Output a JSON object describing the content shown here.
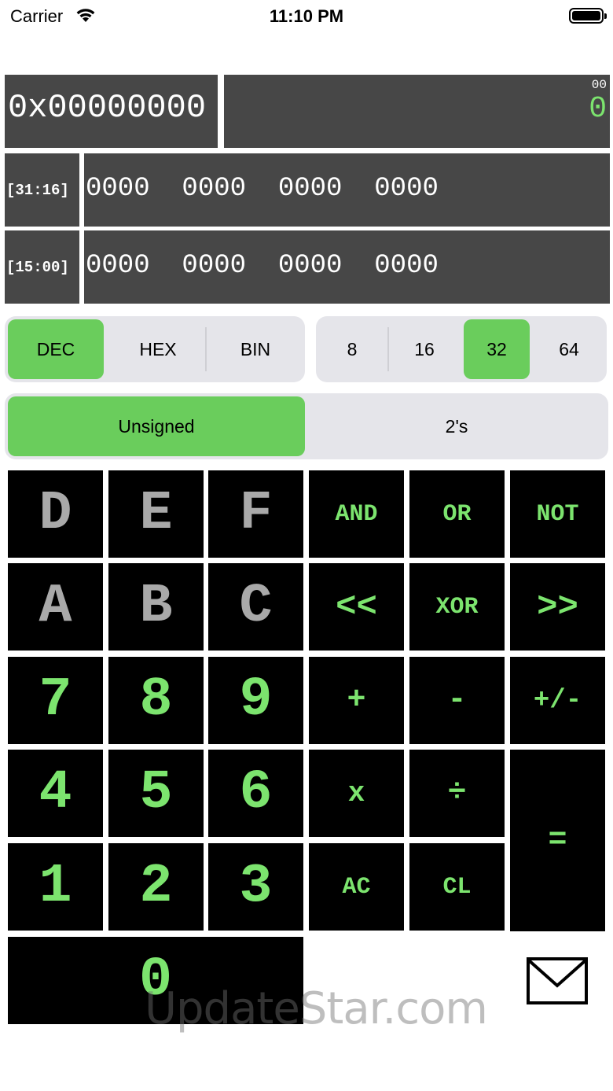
{
  "status_bar": {
    "carrier": "Carrier",
    "time": "11:10 PM",
    "wifi_icon": "wifi-icon",
    "battery_icon": "battery-icon"
  },
  "display": {
    "hex_value": "0x00000000",
    "dec_sub": "00",
    "dec_value": "0",
    "rows": [
      {
        "label": "[31:16]",
        "bits": "0000  0000  0000  0000"
      },
      {
        "label": "[15:00]",
        "bits": "0000  0000  0000  0000"
      }
    ]
  },
  "mode_segment": {
    "options": [
      "DEC",
      "HEX",
      "BIN"
    ],
    "selected": "DEC"
  },
  "width_segment": {
    "options": [
      "8",
      "16",
      "32",
      "64"
    ],
    "selected": "32"
  },
  "sign_segment": {
    "options": [
      "Unsigned",
      "2's"
    ],
    "selected": "Unsigned"
  },
  "keys": {
    "d": "D",
    "e": "E",
    "f": "F",
    "and": "AND",
    "or": "OR",
    "not": "NOT",
    "a": "A",
    "b": "B",
    "c": "C",
    "shl": "<<",
    "xor": "XOR",
    "shr": ">>",
    "k7": "7",
    "k8": "8",
    "k9": "9",
    "plus": "+",
    "minus": "-",
    "negate": "+/-",
    "k4": "4",
    "k5": "5",
    "k6": "6",
    "mul": "x",
    "div": "÷",
    "equals": "=",
    "k1": "1",
    "k2": "2",
    "k3": "3",
    "ac": "AC",
    "cl": "CL",
    "k0": "0"
  },
  "mail_icon": "mail-icon",
  "watermark": "UpdateStar.com",
  "colors": {
    "accent_green": "#6acd5c",
    "key_text_green": "#7ce46e",
    "hex_key_gray": "#a9a9a9",
    "panel_bg": "#474747",
    "segment_bg": "#e5e5ea"
  }
}
